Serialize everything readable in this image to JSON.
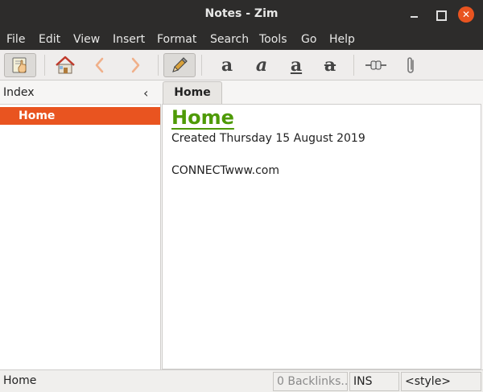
{
  "window": {
    "title": "Notes - Zim"
  },
  "menu": [
    "File",
    "Edit",
    "View",
    "Insert",
    "Format",
    "Search",
    "Tools",
    "Go",
    "Help"
  ],
  "toolbar": {
    "icons": [
      "notebook-icon",
      "home-icon",
      "back-icon",
      "forward-icon",
      "edit-pencil-icon",
      "bold-icon",
      "italic-icon",
      "underline-icon",
      "strikethrough-icon",
      "link-icon",
      "attach-icon"
    ],
    "format_glyph": "a"
  },
  "index": {
    "label": "Index",
    "items": [
      {
        "label": "Home"
      }
    ]
  },
  "tabs": [
    {
      "label": "Home"
    }
  ],
  "page": {
    "heading": "Home",
    "created": "Created Thursday 15 August 2019",
    "body": "CONNECTwww.com"
  },
  "status": {
    "page": "Home",
    "backlinks": "0 Backlinks...",
    "mode": "INS",
    "style": "<style>"
  },
  "colors": {
    "selection": "#e95420",
    "heading": "#4e9a06",
    "titlebar": "#2d2c2b"
  }
}
